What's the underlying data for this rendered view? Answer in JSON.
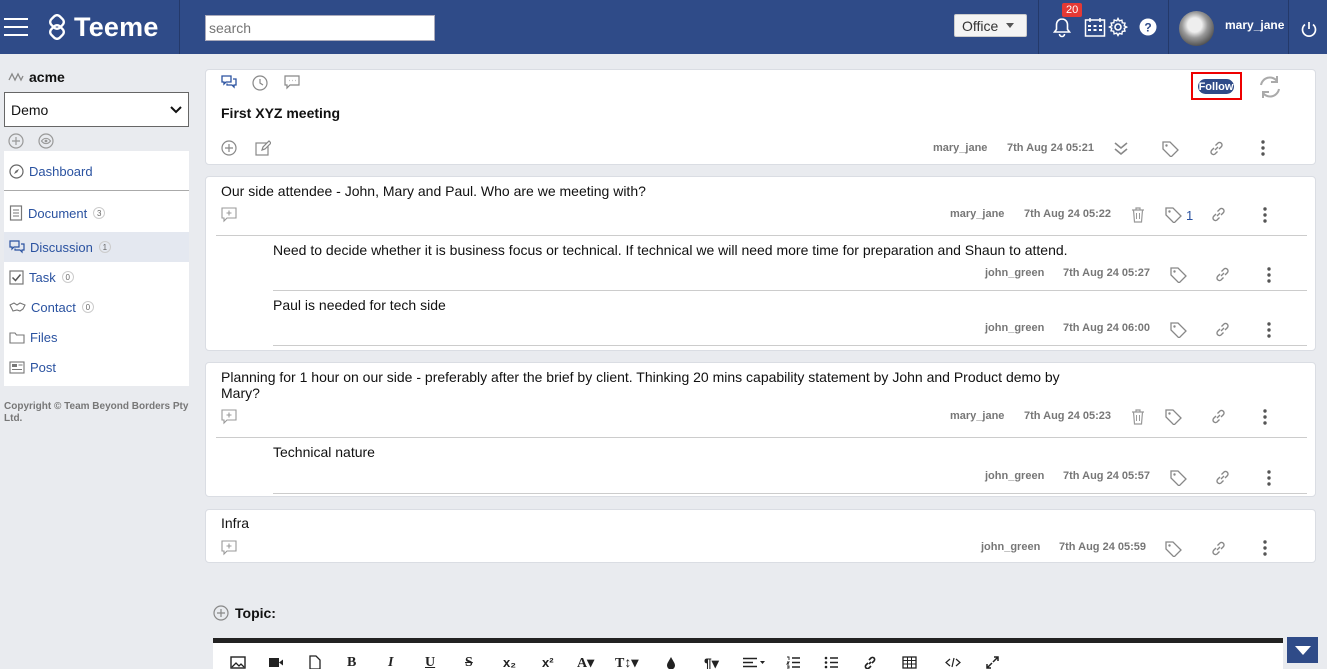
{
  "header": {
    "logo": "Teeme",
    "search_placeholder": "search",
    "office_label": "Office",
    "notification_count": "20",
    "username": "mary_jane"
  },
  "sidebar": {
    "org": "acme",
    "workspace": "Demo",
    "items": [
      {
        "label": "Dashboard",
        "count": ""
      },
      {
        "label": "Document",
        "count": "3"
      },
      {
        "label": "Discussion",
        "count": "1"
      },
      {
        "label": "Task",
        "count": "0"
      },
      {
        "label": "Contact",
        "count": "0"
      },
      {
        "label": "Files",
        "count": ""
      },
      {
        "label": "Post",
        "count": ""
      }
    ],
    "copyright": "Copyright © Team Beyond Borders Pty Ltd."
  },
  "topic": {
    "title": "First XYZ meeting",
    "follow_label": "Follow",
    "user": "mary_jane",
    "time": "7th Aug 24 05:21"
  },
  "posts": [
    {
      "text": "Our side attendee - John, Mary and Paul. Who are we meeting with?",
      "user": "mary_jane",
      "time": "7th Aug 24 05:22",
      "tag_count": "1",
      "replies": [
        {
          "text": "Need to decide whether it is business focus or technical. If technical we will need more time for preparation and Shaun to attend.",
          "user": "john_green",
          "time": "7th Aug 24 05:27"
        },
        {
          "text": "Paul is needed for tech side",
          "user": "john_green",
          "time": "7th Aug 24 06:00"
        }
      ]
    },
    {
      "text": "Planning for 1 hour on our side - preferably after the brief by client. Thinking 20 mins capability statement by John and Product demo by Mary?",
      "user": "mary_jane",
      "time": "7th Aug 24 05:23",
      "replies": [
        {
          "text": "Technical nature",
          "user": "john_green",
          "time": "7th Aug 24 05:57"
        }
      ]
    },
    {
      "text": "Infra",
      "user": "john_green",
      "time": "7th Aug 24 05:59",
      "replies": []
    }
  ],
  "editor": {
    "topic_label": "Topic:",
    "toolbar": [
      "B",
      "I",
      "U",
      "S",
      "x₂",
      "x²",
      "A▾",
      "T↕▾",
      "¶▾"
    ]
  },
  "colors": {
    "header_bg": "#2f4b88",
    "link": "#2a52a0",
    "highlight": "#ee0000"
  }
}
